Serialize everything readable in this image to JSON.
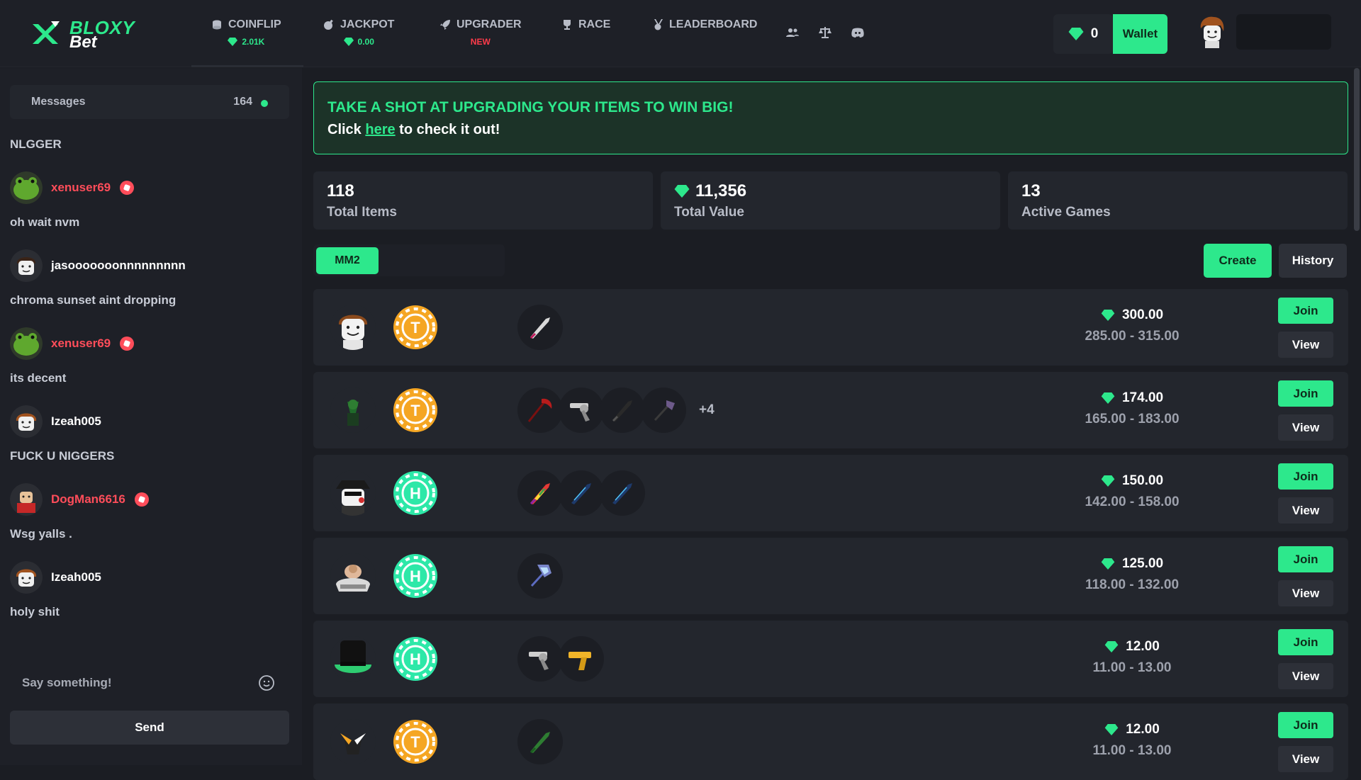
{
  "brand": {
    "line1": "BLOXY",
    "line2": "Bet"
  },
  "nav": [
    {
      "label": "COINFLIP",
      "sub": "2.01K",
      "icon": "coins-icon"
    },
    {
      "label": "JACKPOT",
      "sub": "0.00",
      "icon": "bomb-icon"
    },
    {
      "label": "UPGRADER",
      "sub": "NEW",
      "icon": "rocket-icon"
    },
    {
      "label": "RACE",
      "icon": "trophy-icon"
    },
    {
      "label": "LEADERBOARD",
      "icon": "medal-icon"
    }
  ],
  "header": {
    "balance": "0",
    "wallet_label": "Wallet"
  },
  "chat": {
    "title": "Messages",
    "count": "164",
    "messages": [
      {
        "text": "NLGGER"
      },
      {
        "user": "xenuser69",
        "text": "oh wait nvm",
        "staff": true
      },
      {
        "user": "jasooooooonnnnnnnnn",
        "text": "chroma sunset aint dropping",
        "staff": false
      },
      {
        "user": "xenuser69",
        "text": "its decent",
        "staff": true
      },
      {
        "user": "Izeah005",
        "text": "FUCK U NIGGERS",
        "staff": false
      },
      {
        "user": "DogMan6616",
        "text": "Wsg yalls .",
        "staff": true
      },
      {
        "user": "Izeah005",
        "text": "holy shit",
        "staff": false
      }
    ],
    "input_placeholder": "Say something!",
    "send_label": "Send"
  },
  "banner": {
    "title": "TAKE A SHOT AT UPGRADING YOUR ITEMS TO WIN BIG!",
    "pre": "Click ",
    "link": "here",
    "post": " to check it out!"
  },
  "stats": [
    {
      "value": "118",
      "label": "Total Items"
    },
    {
      "value": "11,356",
      "label": "Total Value"
    },
    {
      "value": "13",
      "label": "Active Games"
    }
  ],
  "controls": {
    "tab": "MM2",
    "create": "Create",
    "history": "History"
  },
  "games": [
    {
      "side": "T",
      "value": "300.00",
      "range": "285.00 - 315.00",
      "more": "",
      "join": "Join",
      "view": "View"
    },
    {
      "side": "T",
      "value": "174.00",
      "range": "165.00 - 183.00",
      "more": "+4",
      "join": "Join",
      "view": "View"
    },
    {
      "side": "H",
      "value": "150.00",
      "range": "142.00 - 158.00",
      "more": "",
      "join": "Join",
      "view": "View"
    },
    {
      "side": "H",
      "value": "125.00",
      "range": "118.00 - 132.00",
      "more": "",
      "join": "Join",
      "view": "View"
    },
    {
      "side": "H",
      "value": "12.00",
      "range": "11.00 - 13.00",
      "more": "",
      "join": "Join",
      "view": "View"
    },
    {
      "side": "T",
      "value": "12.00",
      "range": "11.00 - 13.00",
      "more": "",
      "join": "Join",
      "view": "View"
    }
  ],
  "colors": {
    "accent": "#2de88c",
    "danger": "#ff4d5a",
    "gold": "#f5a623",
    "heads": "#2de8a8"
  }
}
